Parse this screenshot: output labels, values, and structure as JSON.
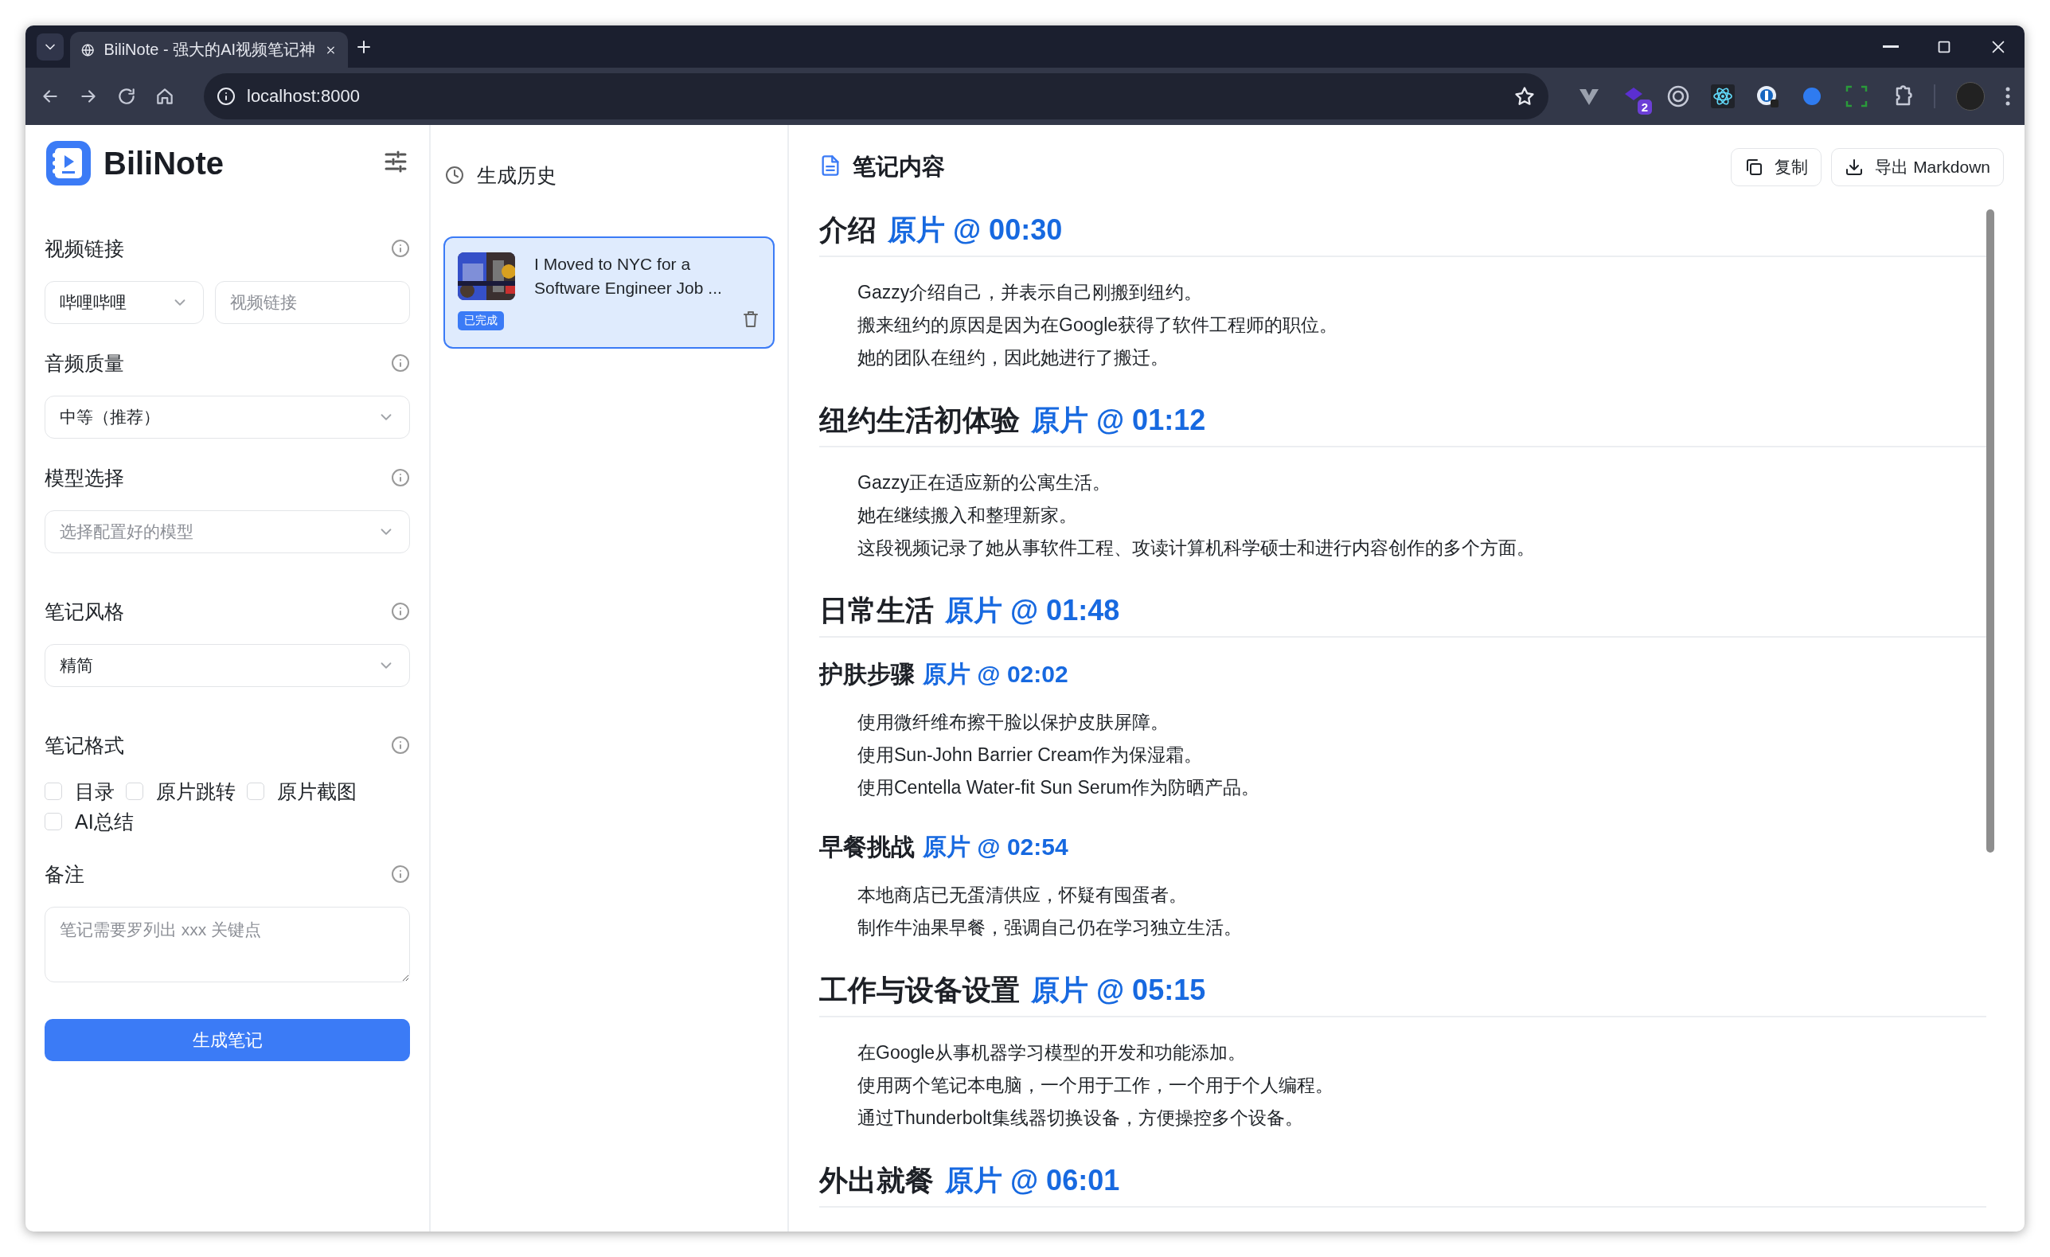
{
  "browser": {
    "tab_title": "BiliNote - 强大的AI视频笔记神",
    "url": "localhost:8000",
    "extension_badge": "2"
  },
  "sidebar": {
    "logo": "BiliNote",
    "sections": [
      {
        "label": "视频链接",
        "kind": "link",
        "platform": "哔哩哔哩",
        "placeholder": "视频链接"
      },
      {
        "label": "音频质量",
        "kind": "select",
        "value": "中等（推荐）"
      },
      {
        "label": "模型选择",
        "kind": "select",
        "placeholder": "选择配置好的模型"
      },
      {
        "label": "笔记风格",
        "kind": "select",
        "value": "精简"
      },
      {
        "label": "笔记格式",
        "kind": "checkboxes",
        "options": [
          {
            "label": "目录",
            "checked": false
          },
          {
            "label": "原片跳转",
            "checked": false
          },
          {
            "label": "原片截图",
            "checked": false
          },
          {
            "label": "AI总结",
            "checked": false
          }
        ]
      },
      {
        "label": "备注",
        "kind": "textarea",
        "placeholder": "笔记需要罗列出 xxx 关键点"
      }
    ],
    "submit": "生成笔记"
  },
  "history": {
    "title": "生成历史",
    "items": [
      {
        "title": "I Moved to NYC for a Software Engineer Job ...",
        "status": "已完成",
        "selected": true
      }
    ]
  },
  "notes": {
    "title": "笔记内容",
    "buttons": [
      {
        "label": "复制",
        "kind": "copy"
      },
      {
        "label": "导出 Markdown",
        "kind": "download"
      }
    ],
    "sections": [
      {
        "kind": "h2",
        "title": "介绍",
        "link": "原片 @ 00:30",
        "lines": [
          "Gazzy介绍自己，并表示自己刚搬到纽约。",
          "搬来纽约的原因是因为在Google获得了软件工程师的职位。",
          "她的团队在纽约，因此她进行了搬迁。"
        ]
      },
      {
        "kind": "h2",
        "title": "纽约生活初体验",
        "link": "原片 @ 01:12",
        "lines": [
          "Gazzy正在适应新的公寓生活。",
          "她在继续搬入和整理新家。",
          "这段视频记录了她从事软件工程、攻读计算机科学硕士和进行内容创作的多个方面。"
        ]
      },
      {
        "kind": "h2",
        "title": "日常生活",
        "link": "原片 @ 01:48"
      },
      {
        "kind": "h3",
        "title": "护肤步骤",
        "link": "原片 @ 02:02",
        "lines": [
          "使用微纤维布擦干脸以保护皮肤屏障。",
          "使用Sun-John Barrier Cream作为保湿霜。",
          "使用Centella Water-fit Sun Serum作为防晒产品。"
        ]
      },
      {
        "kind": "h3",
        "title": "早餐挑战",
        "link": "原片 @ 02:54",
        "lines": [
          "本地商店已无蛋清供应，怀疑有囤蛋者。",
          "制作牛油果早餐，强调自己仍在学习独立生活。"
        ]
      },
      {
        "kind": "h2",
        "title": "工作与设备设置",
        "link": "原片 @ 05:15",
        "lines": [
          "在Google从事机器学习模型的开发和功能添加。",
          "使用两个笔记本电脑，一个用于工作，一个用于个人编程。",
          "通过Thunderbolt集线器切换设备，方便操控多个设备。"
        ]
      },
      {
        "kind": "h2",
        "title": "外出就餐",
        "link": "原片 @ 06:01"
      }
    ]
  }
}
